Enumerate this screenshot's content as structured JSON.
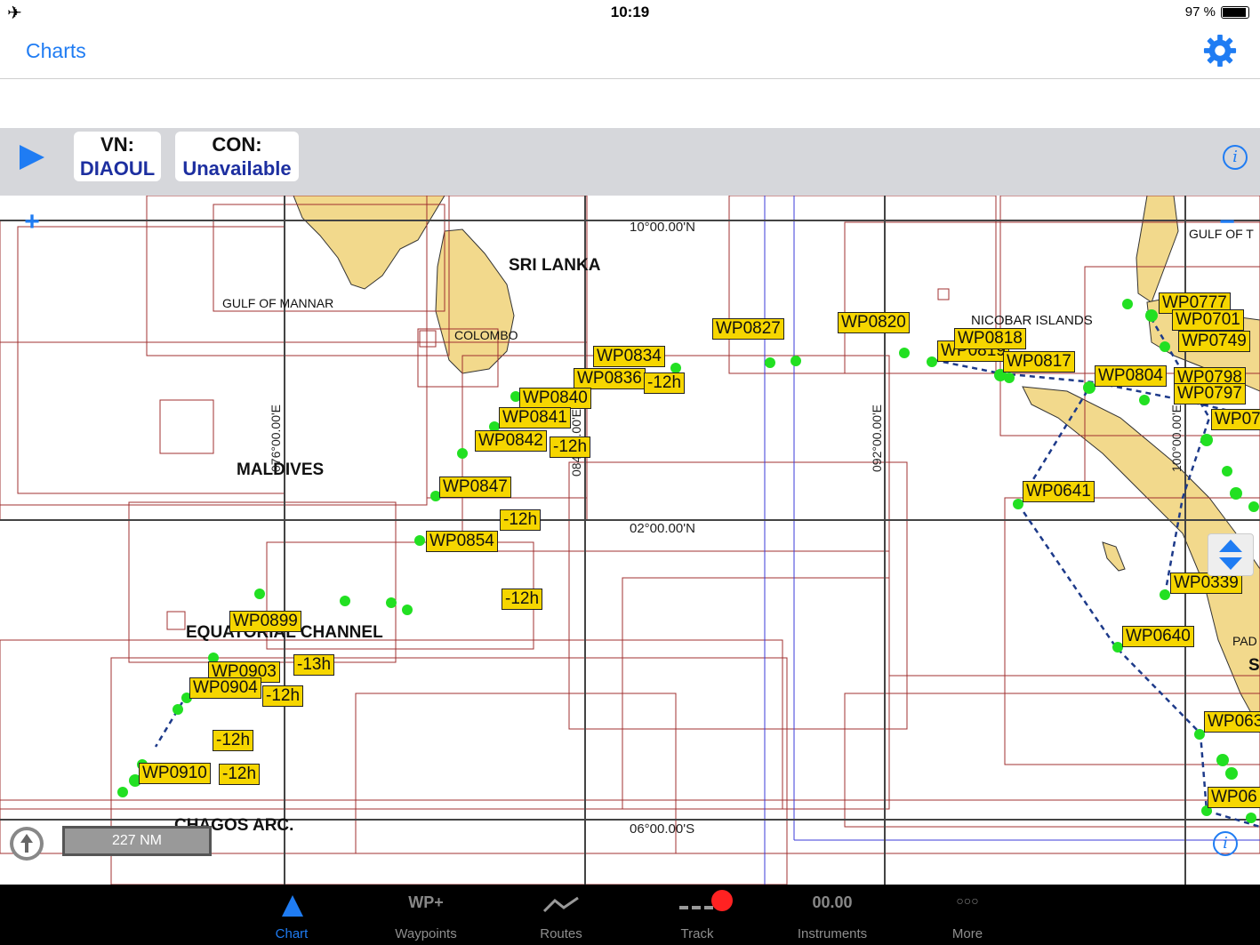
{
  "status_bar": {
    "time": "10:19",
    "battery": "97 %"
  },
  "nav": {
    "back_label": "Charts"
  },
  "toolbar": {
    "vn_label": "VN:",
    "vn_value": "DIAOUL",
    "con_label": "CON:",
    "con_value": "Unavailable"
  },
  "map": {
    "place_labels": {
      "sri_lanka": "SRI LANKA",
      "gulf_of_mannar": "GULF OF MANNAR",
      "colombo": "COLOMBO",
      "maldives": "MALDIVES",
      "equatorial_channel": "EQUATORIAL CHANNEL",
      "chagos": "CHAGOS ARC.",
      "nicobar": "NICOBAR ISLANDS",
      "gulf_top_right": "GULF OF T",
      "pad": "PAD",
      "s": "S"
    },
    "grid_labels": {
      "lat_10n": "10°00.00'N",
      "lat_02n": "02°00.00'N",
      "lat_06s": "06°00.00'S",
      "lon_076e": "076°00.00'E",
      "lon_084e": "084°00.00'E",
      "lon_092e": "092°00.00'E",
      "lon_100e": "100°00.00'E"
    },
    "waypoints": [
      "WP0777",
      "WP0701",
      "WP0749",
      "WP0804",
      "WP0798",
      "WP0797",
      "WP0820",
      "WP0819",
      "WP0818",
      "WP0817",
      "WP0827",
      "WP0834",
      "WP0836",
      "WP0840",
      "WP0841",
      "WP0842",
      "WP0847",
      "WP0854",
      "WP0899",
      "WP0903",
      "WP0904",
      "WP0910",
      "WP0641",
      "WP0339",
      "WP0640",
      "WP063",
      "WP06",
      "WP07"
    ],
    "time_tags": [
      "-12h",
      "-12h",
      "-12h",
      "-13h",
      "-12h",
      "-12h",
      "-12h",
      "-12h"
    ],
    "scale_text": "227 NM"
  },
  "tabs": [
    {
      "label": "Chart",
      "icon": "chart-icon"
    },
    {
      "label": "Waypoints",
      "icon_text": "WP+"
    },
    {
      "label": "Routes",
      "icon": "routes-icon"
    },
    {
      "label": "Track",
      "icon": "track-icon"
    },
    {
      "label": "Instruments",
      "icon_text": "00.00"
    },
    {
      "label": "More",
      "icon_text": "○○○"
    }
  ],
  "colors": {
    "accent": "#1f7cf3",
    "land": "#f2d98c",
    "waypoint": "#f6d600",
    "track": "#22e022",
    "chart_bounds": "#a03030"
  }
}
